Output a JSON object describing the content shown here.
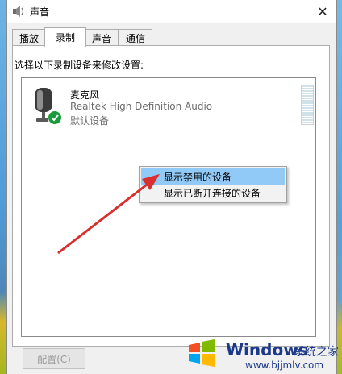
{
  "window": {
    "title": "声音",
    "close_glyph": "✕"
  },
  "tabs": [
    {
      "label": "播放"
    },
    {
      "label": "录制"
    },
    {
      "label": "声音"
    },
    {
      "label": "通信"
    }
  ],
  "recording": {
    "instruction": "选择以下录制设备来修改设置:",
    "devices": [
      {
        "name": "麦克风",
        "description": "Realtek High Definition Audio",
        "status": "默认设备",
        "icon": "microphone-icon",
        "badge_icon": "default-check-icon"
      }
    ]
  },
  "context_menu": {
    "items": [
      {
        "label": "显示禁用的设备",
        "highlighted": true
      },
      {
        "label": "显示已断开连接的设备",
        "highlighted": false
      }
    ]
  },
  "buttons": {
    "configure": "配置(C)"
  },
  "watermark": {
    "brand": "Windows",
    "brand_cn": "系统之家",
    "url": "www.bjjmlv.com"
  },
  "colors": {
    "menu_highlight": "#91c9f7",
    "default_badge": "#1a9a3a",
    "annotation_arrow": "#d8302f",
    "watermark_text": "#1d3a8a"
  }
}
